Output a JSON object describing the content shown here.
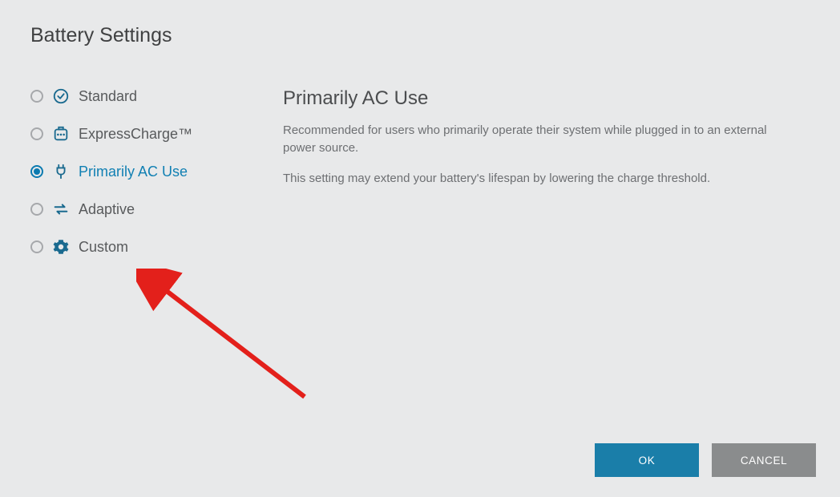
{
  "title": "Battery Settings",
  "options": [
    {
      "label": "Standard"
    },
    {
      "label": "ExpressCharge™"
    },
    {
      "label": "Primarily AC Use"
    },
    {
      "label": "Adaptive"
    },
    {
      "label": "Custom"
    }
  ],
  "detail": {
    "title": "Primarily AC Use",
    "desc1": "Recommended for users who primarily operate their system while plugged in to an external power source.",
    "desc2": "This setting may extend your battery's lifespan by lowering the charge threshold."
  },
  "buttons": {
    "ok": "OK",
    "cancel": "CANCEL"
  }
}
